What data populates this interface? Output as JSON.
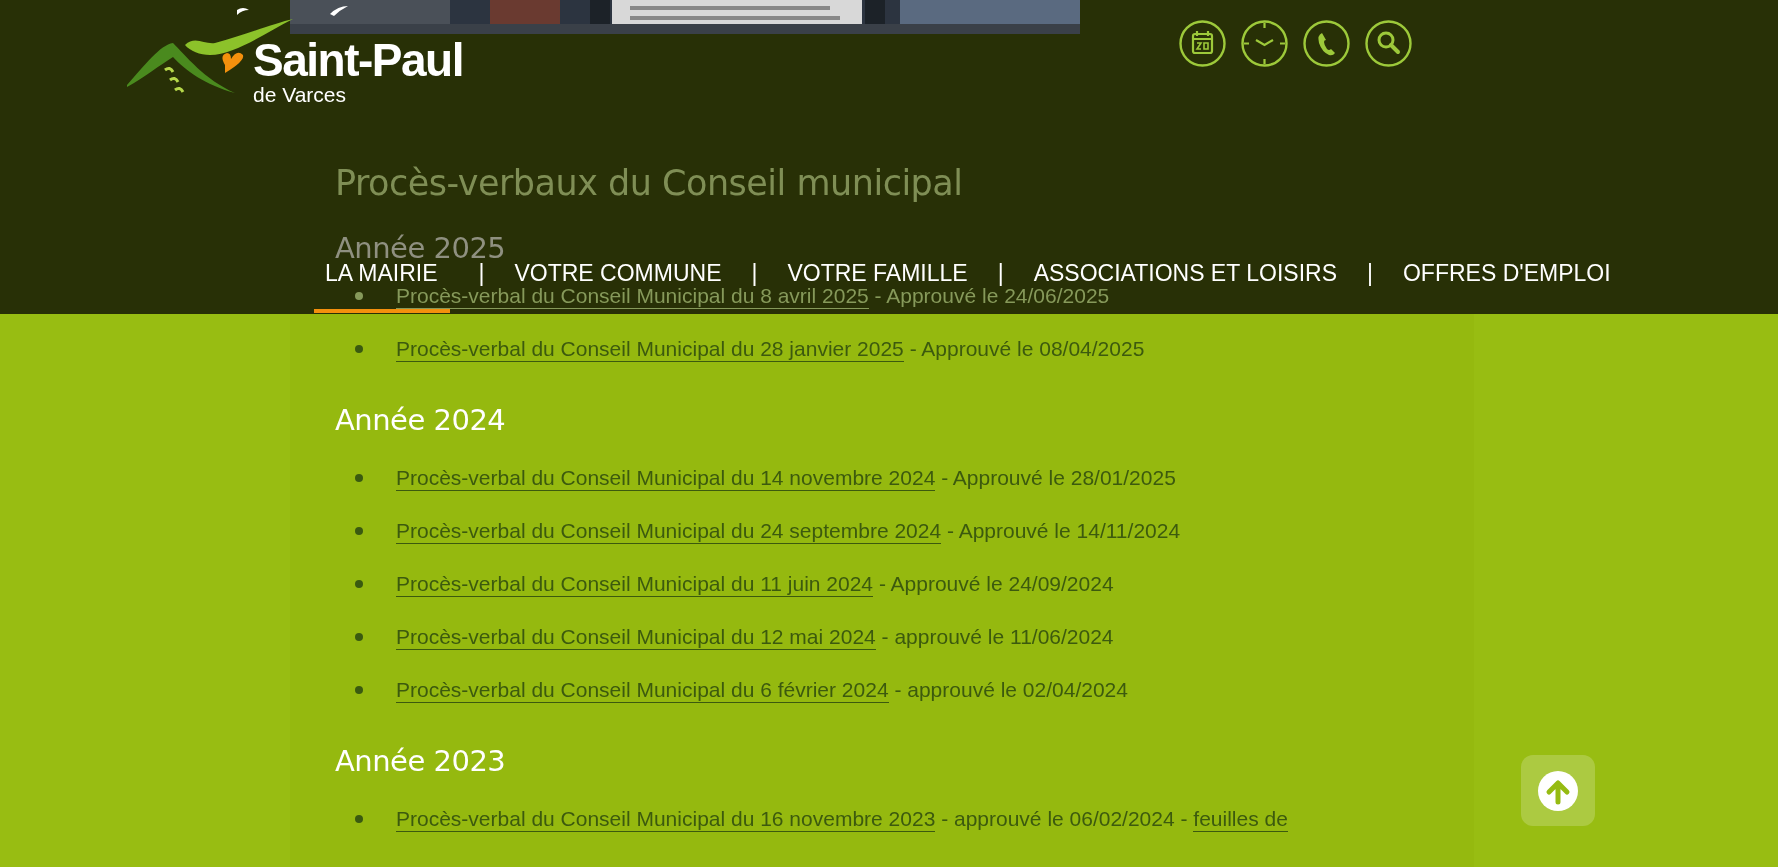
{
  "header": {
    "logo": {
      "name": "Saint-Paul",
      "subtitle": "de Varces"
    },
    "nav": [
      {
        "label": "LA MAIRIE",
        "selected": true
      },
      {
        "label": "VOTRE COMMUNE",
        "selected": false
      },
      {
        "label": "VOTRE FAMILLE",
        "selected": false
      },
      {
        "label": "ASSOCIATIONS ET LOISIRS",
        "selected": false
      },
      {
        "label": "OFFRES D'EMPLOI",
        "selected": false
      }
    ],
    "nav_separators": [
      "|",
      "|",
      "|",
      "|"
    ]
  },
  "content": {
    "title": "Procès-verbaux du Conseil municipal",
    "sections": [
      {
        "heading": "Année 2025",
        "items": [
          {
            "parts": [
              {
                "kind": "link",
                "text": "Procès-verbal du Conseil Municipal du 8 avril 2025"
              },
              {
                "kind": "plain",
                "text": " - Approuvé le 24/06/2025"
              }
            ]
          },
          {
            "parts": [
              {
                "kind": "link",
                "text": "Procès-verbal du Conseil Municipal du 28 janvier 2025"
              },
              {
                "kind": "plain",
                "text": " - Approuvé le 08/04/2025"
              }
            ]
          }
        ]
      },
      {
        "heading": "Année 2024",
        "items": [
          {
            "parts": [
              {
                "kind": "link",
                "text": "Procès-verbal du Conseil Municipal du 14 novembre 2024"
              },
              {
                "kind": "plain",
                "text": " - Approuvé le 28/01/2025"
              }
            ]
          },
          {
            "parts": [
              {
                "kind": "link",
                "text": "Procès-verbal du Conseil Municipal du 24 septembre 2024"
              },
              {
                "kind": "plain",
                "text": " - Approuvé le 14/11/2024"
              }
            ]
          },
          {
            "parts": [
              {
                "kind": "link",
                "text": "Procès-verbal du Conseil Municipal du 11 juin 2024"
              },
              {
                "kind": "plain",
                "text": " - Approuvé le 24/09/2024"
              }
            ]
          },
          {
            "parts": [
              {
                "kind": "link",
                "text": "Procès-verbal du Conseil Municipal du 12 mai 2024"
              },
              {
                "kind": "plain",
                "text": " - approuvé le 11/06/2024"
              }
            ]
          },
          {
            "parts": [
              {
                "kind": "link",
                "text": "Procès-verbal du Conseil Municipal du 6 février 2024"
              },
              {
                "kind": "plain",
                "text": " - approuvé le 02/04/2024"
              }
            ]
          }
        ]
      },
      {
        "heading": "Année 2023",
        "items": [
          {
            "parts": [
              {
                "kind": "link",
                "text": "Procès-verbal du Conseil Municipal du 16 novembre 2023"
              },
              {
                "kind": "plain",
                "text": " - approuvé le 06/02/2024 - "
              },
              {
                "kind": "link",
                "text": "feuilles de"
              }
            ]
          }
        ]
      }
    ]
  }
}
